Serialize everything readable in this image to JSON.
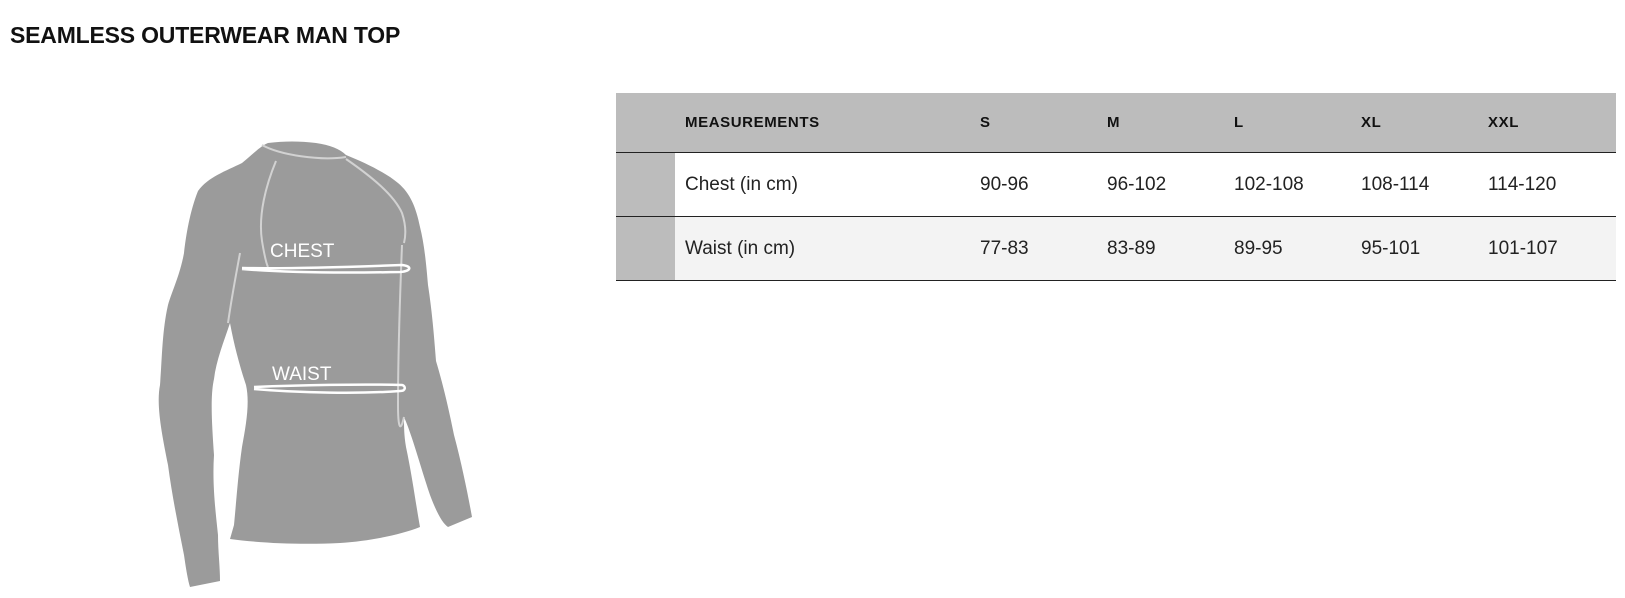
{
  "page": {
    "title": "SEAMLESS OUTERWEAR MAN TOP"
  },
  "figure": {
    "chest_label": "CHEST",
    "waist_label": "WAIST",
    "body_color": "#9b9b9b",
    "line_color": "#ffffff"
  },
  "table": {
    "header_color": "#bcbcbc",
    "headers": [
      "MEASUREMENTS",
      "S",
      "M",
      "L",
      "XL",
      "XXL"
    ],
    "rows": [
      {
        "label": "Chest (in cm)",
        "values": [
          "90-96",
          "96-102",
          "102-108",
          "108-114",
          "114-120"
        ]
      },
      {
        "label": "Waist (in cm)",
        "values": [
          "77-83",
          "83-89",
          "89-95",
          "95-101",
          "101-107"
        ]
      }
    ]
  }
}
